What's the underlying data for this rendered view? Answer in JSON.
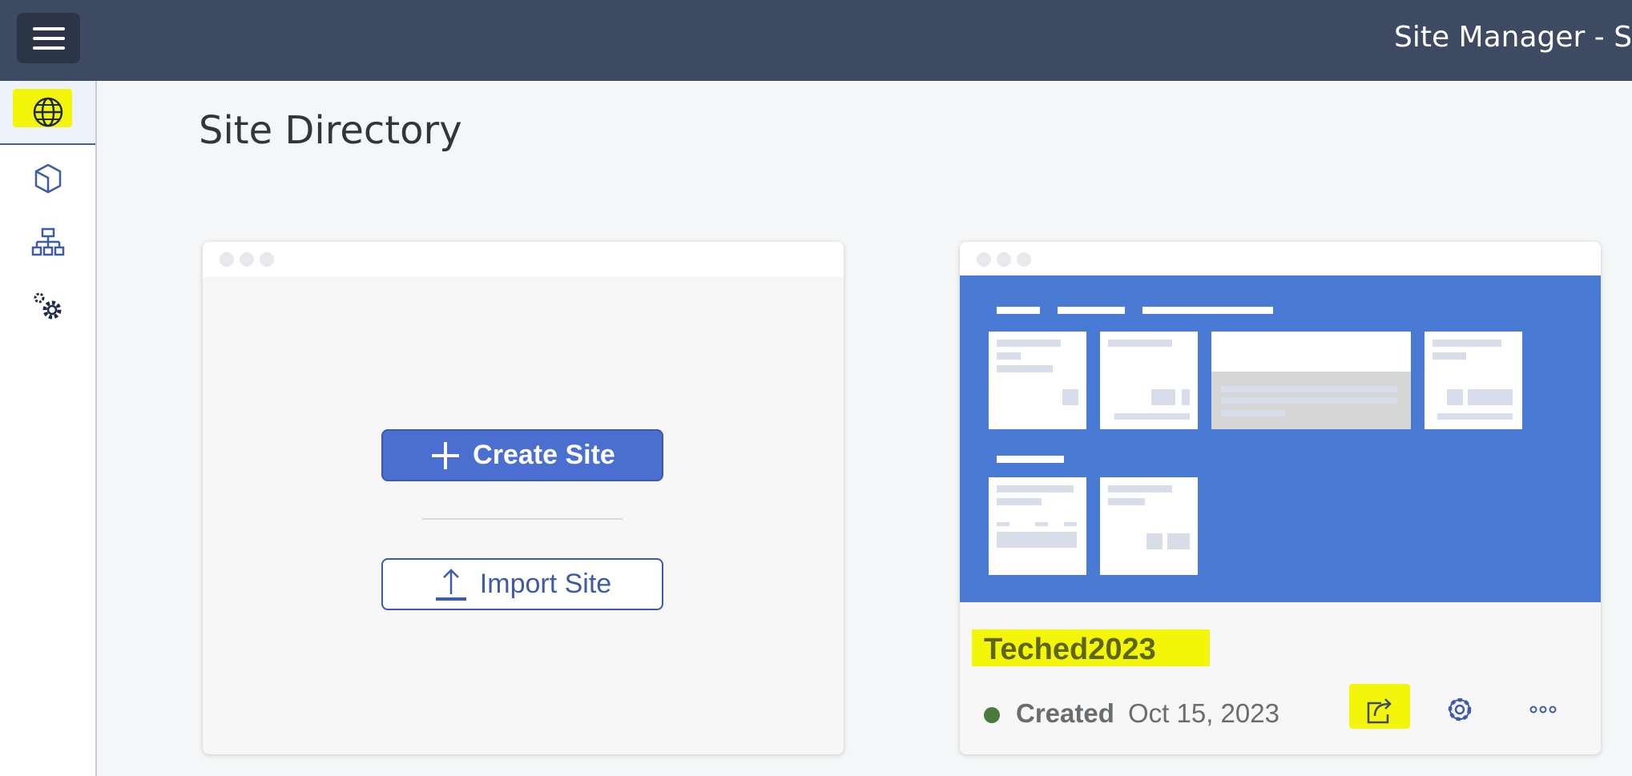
{
  "header": {
    "title": "Site Manager - Site",
    "menu_icon": "hamburger-menu-icon"
  },
  "sidebar": {
    "items": [
      {
        "icon": "globe-icon",
        "active": true
      },
      {
        "icon": "cube-icon"
      },
      {
        "icon": "hierarchy-icon"
      },
      {
        "icon": "settings-gears-icon"
      }
    ]
  },
  "page": {
    "title": "Site Directory"
  },
  "create_card": {
    "create_label": "Create Site",
    "import_label": "Import Site"
  },
  "site_card": {
    "name": "Teched2023",
    "status": "Created",
    "date": "Oct 15, 2023",
    "status_color": "#4c7a3c",
    "actions": [
      "open-site-icon",
      "settings-icon",
      "more-icon"
    ]
  },
  "colors": {
    "header_bg": "#3d4a62",
    "accent": "#3d5ba6",
    "preview_bg": "#4a7bd4",
    "highlight": "#f4f60a"
  }
}
